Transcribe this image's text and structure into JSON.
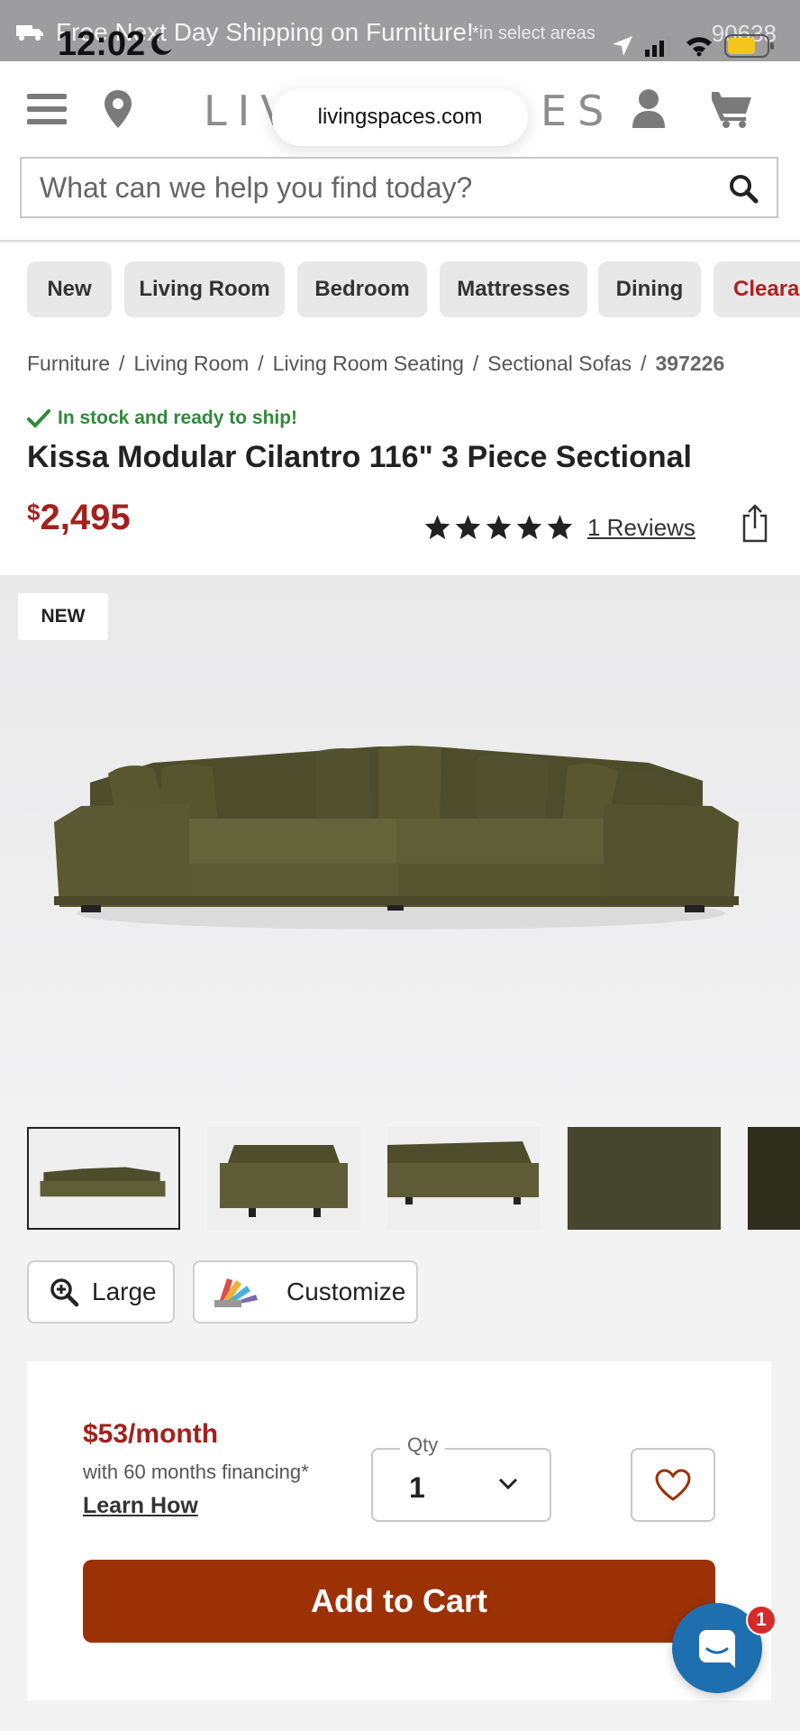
{
  "status_bar": {
    "time": "12:02"
  },
  "promo": {
    "text": "Free Next Day Shipping on Furniture!",
    "note": "*in select areas",
    "zip": "90638"
  },
  "header": {
    "brand_left": "LIV",
    "brand_right": "ES",
    "url": "livingspaces.com",
    "search_placeholder": "What can we help you find today?"
  },
  "categories": [
    "New",
    "Living Room",
    "Bedroom",
    "Mattresses",
    "Dining",
    "Clearan"
  ],
  "breadcrumb": [
    "Furniture",
    "Living Room",
    "Living Room Seating",
    "Sectional Sofas",
    "397226"
  ],
  "product": {
    "stock": "In stock and ready to ship!",
    "title": "Kissa Modular Cilantro 116\" 3 Piece Sectional",
    "currency": "$",
    "price": "2,495",
    "rating": 5,
    "reviews": "1 Reviews",
    "badge": "NEW"
  },
  "tools": {
    "large": "Large",
    "customize": "Customize"
  },
  "purchase": {
    "monthly": "$53/month",
    "financing": "with 60 months financing*",
    "learn": "Learn How",
    "qty_label": "Qty",
    "qty": "1",
    "add_to_cart": "Add to Cart"
  },
  "chat": {
    "badge": "1"
  },
  "colors": {
    "brand_red": "#a3201c",
    "cart_button": "#9b3104",
    "stock_green": "#2f8a3a",
    "chat_blue": "#1d6fb0",
    "sofa": "#5b5a34"
  }
}
